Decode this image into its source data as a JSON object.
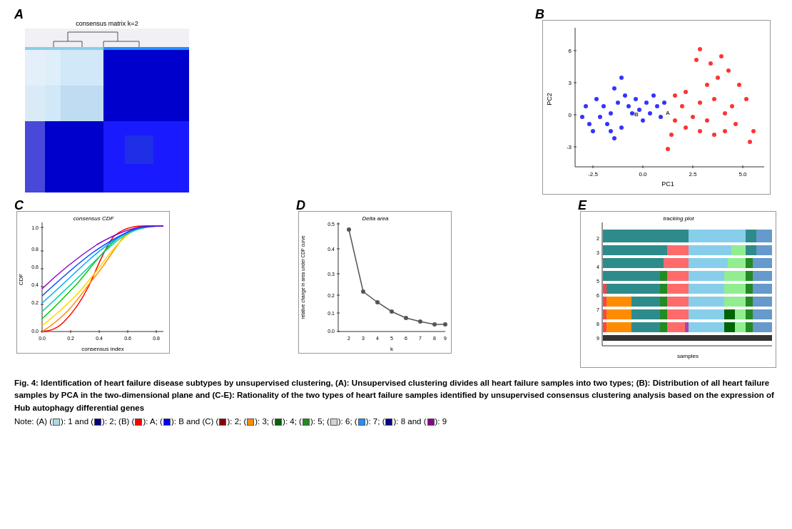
{
  "figure": {
    "title": "Fig. 4",
    "caption_bold": "Fig. 4: Identification of heart failure disease subtypes by unsupervised clustering, (A): Unsupervised clustering divides all heart failure samples into two types; (B): Distribution of all heart failure samples by PCA in the two-dimensional plane and (C-E): Rationality of the two types of heart failure samples identified by unsupervised consensus clustering analysis based on the expression of Hub autophagy differential genes",
    "note": "Note: (A) (",
    "panels": {
      "A": {
        "label": "A",
        "plot_title": "consensus matrix k=2"
      },
      "B": {
        "label": "B"
      },
      "C": {
        "label": "C",
        "plot_title": "consensus CDF",
        "x_label": "consensus index",
        "y_label": "CDF"
      },
      "D": {
        "label": "D",
        "plot_title": "Delta area",
        "x_label": "k",
        "y_label": "relative change in area under CDF curve"
      },
      "E": {
        "label": "E",
        "plot_title": "tracking plot",
        "x_label": "samples",
        "y_label": ""
      }
    },
    "note_items": [
      {
        "panel": "A",
        "color1": "#add8e6",
        "label1": "1 and",
        "color2": "#00008b",
        "label2": "2"
      },
      {
        "panel": "B",
        "color1": "#ff0000",
        "label1": "A",
        "color2": "#0000ff",
        "label2": "B and"
      },
      {
        "panel": "C",
        "colors": [
          "#8b0000",
          "#ff8c00",
          "#006400",
          "#228b22",
          "#d3d3d3",
          "#1e90ff",
          "#00008b",
          "#8b008b"
        ],
        "labels": [
          "2",
          "3",
          "4",
          "5",
          "6",
          "7",
          "8",
          "9"
        ]
      }
    ]
  }
}
